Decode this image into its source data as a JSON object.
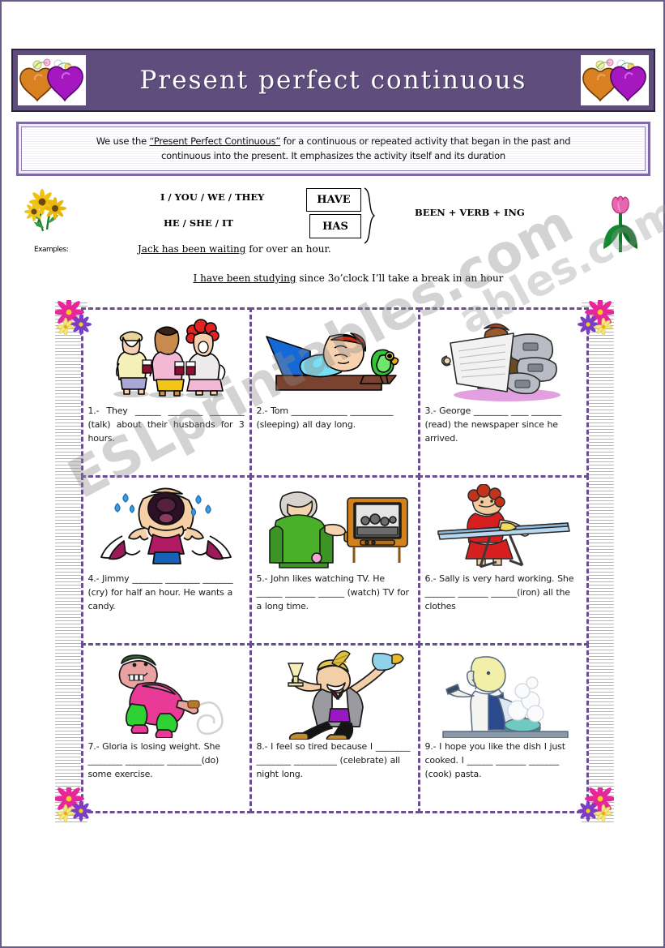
{
  "header": {
    "title": "Present   perfect   continuous",
    "left_decoration": "hearts-with-flowers",
    "right_decoration": "hearts-with-flowers",
    "banner_color": "#5f4d7e"
  },
  "explanation": {
    "line1_pre": "We use the ",
    "line1_quoted": "“Present Perfect Continuous”",
    "line1_post": " for a continuous or repeated activity that began in the past and",
    "line2": "continuous into the present. It emphasizes the activity itself and its duration"
  },
  "formula": {
    "subjects_1": "I / YOU / WE / THEY",
    "subjects_2": "HE / SHE / IT",
    "aux_1": "HAVE",
    "aux_2": "HAS",
    "tail": "BEEN + VERB + ING",
    "examples_label": "Examples:",
    "example_1_underlined": "Jack has been waiting",
    "example_1_rest": " for over an hour.",
    "example_2_underlined": "I have been studying",
    "example_2_rest": " since 3o’clock  I’ll take a break in an hour",
    "left_image": "sunflowers-icon",
    "right_image": "tulip-icon"
  },
  "exercises": [
    {
      "number": "1.-",
      "art": "three-women-talking-icon",
      "text": "1.- They ______ ________ ________ (talk) about their husbands for 3 hours."
    },
    {
      "number": "2.-",
      "art": "man-sleeping-with-parrot-icon",
      "text": "2.- Tom _____________ __________ (sleeping) all day long."
    },
    {
      "number": "3.-",
      "art": "man-reading-newspaper-icon",
      "text": "3.- George ________ ____ _______ (read) the newspaper since he arrived."
    },
    {
      "number": "4.-",
      "art": "crying-child-icon",
      "text": "4.- Jimmy _______ ________ _______ (cry) for half an hour. He wants a candy."
    },
    {
      "number": "5.-",
      "art": "man-watching-tv-icon",
      "text": "5.- John likes watching TV. He ______ _______ ______ (watch) TV for a long time."
    },
    {
      "number": "6.-",
      "art": "woman-ironing-icon",
      "text": "6.- Sally is very hard working. She _______ _______ ______(iron) all the clothes"
    },
    {
      "number": "7.-",
      "art": "woman-exercising-icon",
      "text": "7.- Gloria is losing weight. She ________ _________ ________(do) some exercise."
    },
    {
      "number": "8.-",
      "art": "man-celebrating-icon",
      "text": "8.- I feel so tired because I ________ ________ __________ (celebrate) all night long."
    },
    {
      "number": "9.-",
      "art": "person-cooking-icon",
      "text": "9.- I hope you like the dish I just cooked. I ______ _______ _______ (cook) pasta."
    }
  ],
  "decorations": {
    "corner_flowers": "pink-purple-yellow-flowers"
  },
  "watermark": {
    "text_main": "ESLprintables.com",
    "text_side": "ables.com"
  },
  "colors": {
    "banner": "#5f4d7e",
    "cell_border": "#6a4e91",
    "explain_border": "#7c6aa0",
    "heart_orange": "#d98020",
    "heart_purple": "#a518c0"
  }
}
